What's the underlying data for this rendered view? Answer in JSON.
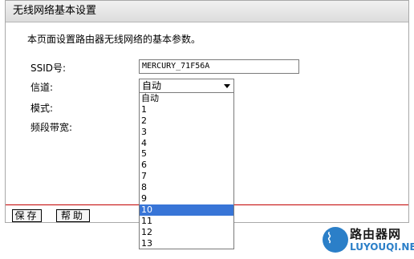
{
  "header": {
    "title": "无线网络基本设置"
  },
  "intro": "本页面设置路由器无线网络的基本参数。",
  "fields": {
    "ssid_label": "SSID号:",
    "ssid_value": "MERCURY_71F56A",
    "channel_label": "信道:",
    "channel_value": "自动",
    "mode_label": "模式:",
    "bandwidth_label": "频段带宽:"
  },
  "channel_options": [
    "自动",
    "1",
    "2",
    "3",
    "4",
    "5",
    "6",
    "7",
    "8",
    "9",
    "10",
    "11",
    "12",
    "13"
  ],
  "channel_highlighted": "10",
  "buttons": {
    "save": "保存",
    "help": "帮助"
  },
  "watermark": {
    "brand": "路由器网",
    "site": "LUYOUQI.NET"
  },
  "colors": {
    "selection": "#3875d7",
    "divider": "#c20000"
  }
}
